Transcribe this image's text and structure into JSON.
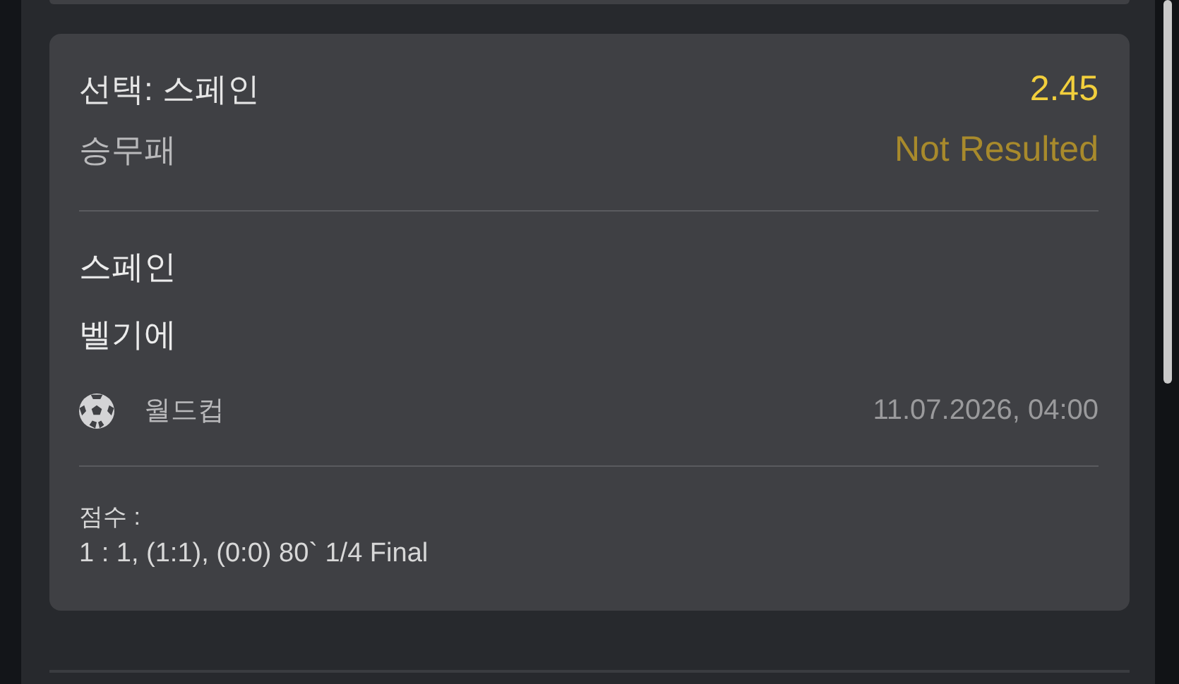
{
  "selection": {
    "label": "선택: 스페인",
    "odds": "2.45"
  },
  "market": {
    "name": "승무패",
    "status": "Not Resulted"
  },
  "teams": [
    "스페인",
    "벨기에"
  ],
  "event": {
    "competition": "월드컵",
    "datetime": "11.07.2026, 04:00"
  },
  "score": {
    "label": "점수 :",
    "value": "1 : 1, (1:1), (0:0) 80` 1/4 Final"
  }
}
